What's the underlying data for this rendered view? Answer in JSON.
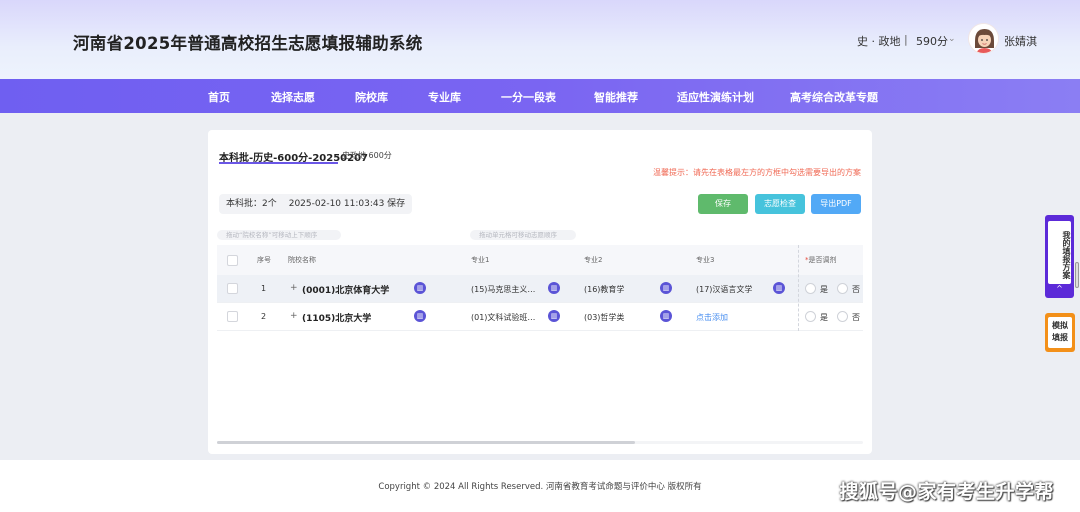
{
  "header": {
    "title": "河南省2025年普通高校招生志愿填报辅助系统",
    "subjects": "史 · 政地",
    "separator": "|",
    "score": "590分",
    "username": "张婧淇"
  },
  "nav": {
    "items": [
      "首页",
      "选择志愿",
      "院校库",
      "专业库",
      "一分一段表",
      "智能推荐",
      "适应性演练计划",
      "高考综合改革专题"
    ]
  },
  "plan": {
    "title": "本科批-历史-600分-20250207",
    "meta": "史政地 600分",
    "tip": "温馨提示：请先在表格最左方的方框中勾选需要导出的方案",
    "count": "本科批：2个",
    "saved_at": "2025-02-10 11:03:43 保存",
    "buttons": {
      "save": "保存",
      "check": "志愿检查",
      "pdf": "导出PDF"
    },
    "hint_drag_school": "拖动“院校名称”可移动上下顺序",
    "hint_drag_cell": "拖动单元格可移动志愿顺序"
  },
  "table": {
    "headers": {
      "index": "序号",
      "school": "院校名称",
      "major1": "专业1",
      "major2": "专业2",
      "major3": "专业3",
      "adjust": "是否调剂",
      "adjust_required": "*"
    },
    "rows": [
      {
        "index": "1",
        "school": "(0001)北京体育大学",
        "major1": "(15)马克思主义…",
        "major2": "(16)教育学",
        "major3": "(17)汉语言文学"
      },
      {
        "index": "2",
        "school": "(1105)北京大学",
        "major1": "(01)文科试验班…",
        "major2": "(03)哲学类",
        "major3": "点击添加"
      }
    ],
    "yes": "是",
    "no": "否",
    "plus": "+"
  },
  "side": {
    "my_plan": "我的填报方案",
    "up_arrow": "^",
    "mock": "模拟填报"
  },
  "footer": {
    "copyright": "Copyright © 2024 All Rights Reserved. 河南省教育考试命题与评价中心  版权所有",
    "watermark": "搜狐号@家有考生升学帮"
  },
  "colors": {
    "nav": "#7566f2",
    "save": "#5fba6c",
    "check": "#46c3dc",
    "pdf": "#52a9f6",
    "side_blue": "#5c2ad8",
    "side_orange": "#f39019",
    "tip": "#f06a55"
  },
  "icons": [
    "user-avatar",
    "chevron-down-icon",
    "chart-icon",
    "plus-icon",
    "arrow-up-icon"
  ]
}
